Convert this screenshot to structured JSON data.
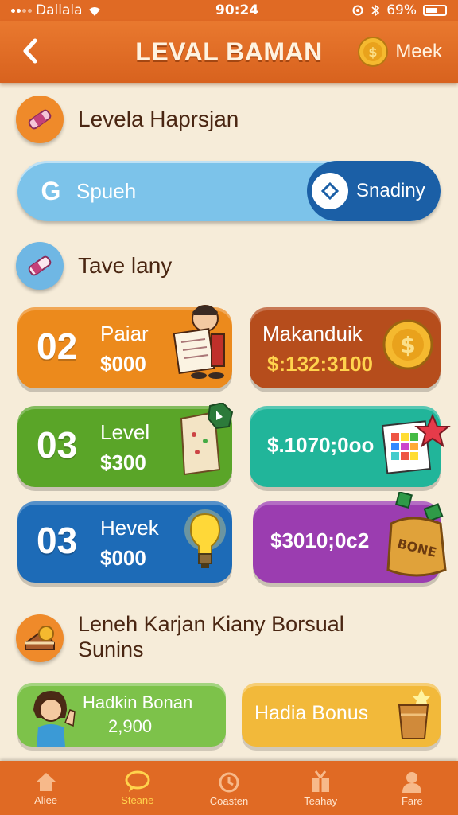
{
  "status_bar": {
    "carrier": "Dallala",
    "time": "90:24",
    "battery": "69%"
  },
  "header": {
    "title": "LEVAL BAMAN",
    "coin_label": "Meek"
  },
  "section1": {
    "title": "Levela Haprsjan"
  },
  "search": {
    "placeholder": "Spueh",
    "action_label": "Snadiny"
  },
  "section2": {
    "title": "Tave lany"
  },
  "cards": [
    {
      "number": "02",
      "line1": "Paiar",
      "line2": "$000",
      "color": "#ec8a1c"
    },
    {
      "line1": "Makanduik",
      "line2": "$:132:3100",
      "color": "#b64d1c"
    },
    {
      "number": "03",
      "line1": "Level",
      "line2": "$300",
      "color": "#5aa528"
    },
    {
      "line1": "$.1070;0oo",
      "color": "#21b59a"
    },
    {
      "number": "03",
      "line1": "Hevek",
      "line2": "$000",
      "color": "#1d6bb7"
    },
    {
      "line1": "$3010;0c2",
      "color": "#9b3db0",
      "art_label": "BONE"
    }
  ],
  "section3": {
    "title_line1": "Leneh Karjan Kiany Borsual",
    "title_line2": "Sunins"
  },
  "bonus_cards": [
    {
      "line1": "Hadkin Bonan",
      "line2": "2,900",
      "color": "#7dc24a"
    },
    {
      "line1": "Hadia Bonus",
      "color": "#f2b93a"
    }
  ],
  "tabs": [
    {
      "label": "Aliee",
      "icon": "home-icon"
    },
    {
      "label": "Steane",
      "icon": "chat-icon",
      "active": true
    },
    {
      "label": "Coasten",
      "icon": "timer-icon"
    },
    {
      "label": "Teahay",
      "icon": "gift-icon"
    },
    {
      "label": "Fare",
      "icon": "profile-icon"
    }
  ]
}
